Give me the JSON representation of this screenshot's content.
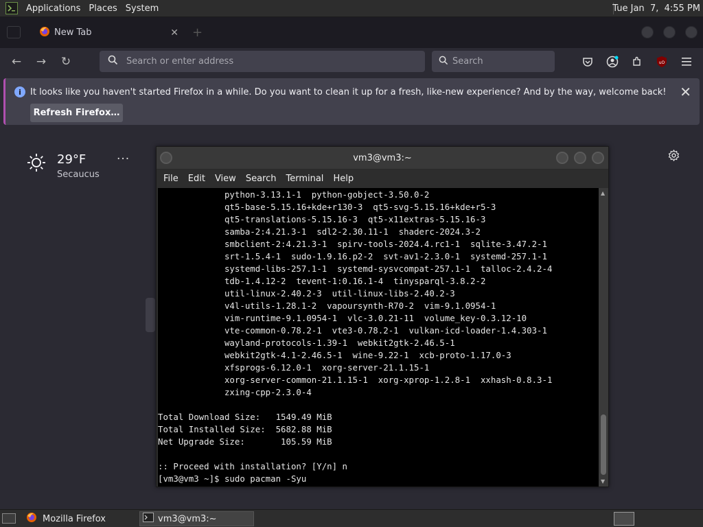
{
  "top_panel": {
    "menus": [
      "Applications",
      "Places",
      "System"
    ],
    "clock": "Tue Jan  7,  4:55 PM"
  },
  "browser": {
    "tab_title": "New Tab",
    "url_placeholder": "Search or enter address",
    "search_placeholder": "Search",
    "notification": {
      "message": "It looks like you haven't started Firefox in a while. Do you want to clean it up for a fresh, like-new experience? And by the way, welcome back!",
      "button": "Refresh Firefox…"
    },
    "weather": {
      "temperature": "29°F",
      "location": "Secaucus",
      "more": "···"
    }
  },
  "terminal": {
    "title": "vm3@vm3:~",
    "menu": [
      "File",
      "Edit",
      "View",
      "Search",
      "Terminal",
      "Help"
    ],
    "lines": [
      "             python-3.13.1-1  python-gobject-3.50.0-2",
      "             qt5-base-5.15.16+kde+r130-3  qt5-svg-5.15.16+kde+r5-3",
      "             qt5-translations-5.15.16-3  qt5-x11extras-5.15.16-3",
      "             samba-2:4.21.3-1  sdl2-2.30.11-1  shaderc-2024.3-2",
      "             smbclient-2:4.21.3-1  spirv-tools-2024.4.rc1-1  sqlite-3.47.2-1",
      "             srt-1.5.4-1  sudo-1.9.16.p2-2  svt-av1-2.3.0-1  systemd-257.1-1",
      "             systemd-libs-257.1-1  systemd-sysvcompat-257.1-1  talloc-2.4.2-4",
      "             tdb-1.4.12-2  tevent-1:0.16.1-4  tinysparql-3.8.2-2",
      "             util-linux-2.40.2-3  util-linux-libs-2.40.2-3",
      "             v4l-utils-1.28.1-2  vapoursynth-R70-2  vim-9.1.0954-1",
      "             vim-runtime-9.1.0954-1  vlc-3.0.21-11  volume_key-0.3.12-10",
      "             vte-common-0.78.2-1  vte3-0.78.2-1  vulkan-icd-loader-1.4.303-1",
      "             wayland-protocols-1.39-1  webkit2gtk-2.46.5-1",
      "             webkit2gtk-4.1-2.46.5-1  wine-9.22-1  xcb-proto-1.17.0-3",
      "             xfsprogs-6.12.0-1  xorg-server-21.1.15-1",
      "             xorg-server-common-21.1.15-1  xorg-xprop-1.2.8-1  xxhash-0.8.3-1",
      "             zxing-cpp-2.3.0-4",
      "",
      "Total Download Size:   1549.49 MiB",
      "Total Installed Size:  5682.88 MiB",
      "Net Upgrade Size:       105.59 MiB",
      "",
      ":: Proceed with installation? [Y/n] n",
      "[vm3@vm3 ~]$ sudo pacman -Syu"
    ]
  },
  "taskbar": {
    "items": [
      "Mozilla Firefox",
      "vm3@vm3:~"
    ]
  }
}
